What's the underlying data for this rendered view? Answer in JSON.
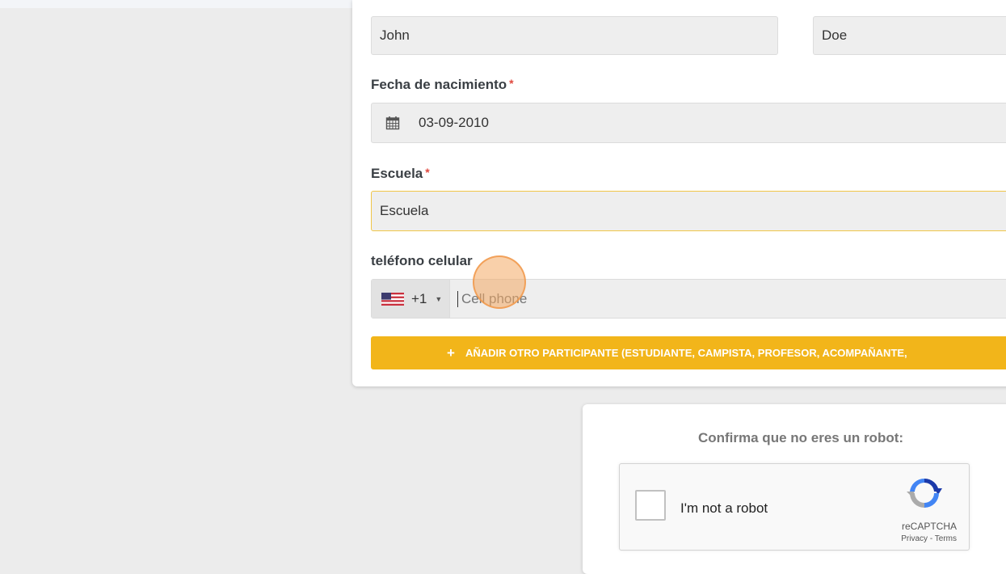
{
  "form": {
    "first_name_value": "John",
    "last_name_value": "Doe",
    "birth_date_label": "Fecha de nacimiento",
    "birth_date_value": "03-09-2010",
    "school_label": "Escuela",
    "school_value": "Escuela",
    "phone_label": "teléfono celular",
    "phone_country_code": "+1",
    "phone_placeholder": "Cell phone",
    "required_mark": "*",
    "add_participant_label": "AÑADIR OTRO PARTICIPANTE (ESTUDIANTE, CAMPISTA, PROFESOR, ACOMPAÑANTE,"
  },
  "captcha": {
    "heading": "Confirma que no eres un robot:",
    "checkbox_label": "I'm not a robot",
    "brand": "reCAPTCHA",
    "privacy": "Privacy",
    "separator": " - ",
    "terms": "Terms"
  },
  "icons": {
    "calendar": "calendar-icon",
    "flag": "us-flag-icon",
    "plus": "plus-icon",
    "recaptcha": "recaptcha-logo-icon"
  },
  "colors": {
    "accent": "#f2b51a",
    "required": "#e0483e",
    "focus_border": "#f0c648"
  }
}
